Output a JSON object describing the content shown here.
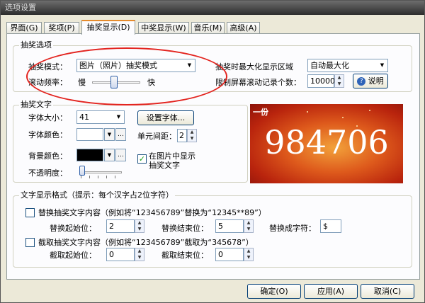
{
  "window": {
    "title": "选项设置"
  },
  "tabs": [
    {
      "label": "界面(G)"
    },
    {
      "label": "奖项(P)"
    },
    {
      "label": "抽奖显示(D)"
    },
    {
      "label": "中奖显示(W)"
    },
    {
      "label": "音乐(M)"
    },
    {
      "label": "高级(A)"
    }
  ],
  "lottery_options": {
    "title": "抽奖选项",
    "mode_label": "抽奖模式：",
    "mode_value": "图片（照片）抽奖模式",
    "speed_label": "滚动频率：",
    "speed_slow": "慢",
    "speed_fast": "快",
    "speed_level": 0.45,
    "maximize_label": "抽奖时最大化显示区域",
    "maximize_value": "自动最大化",
    "limit_label": "限制屏幕滚动记录个数：",
    "limit_value": "10000",
    "help_button": "说明"
  },
  "lottery_text": {
    "title": "抽奖文字",
    "font_size_label": "字体大小：",
    "font_size_value": "41",
    "font_color_label": "字体颜色：",
    "font_color": "#ffffff",
    "set_font_button": "设置字体...",
    "cell_spacing_label": "单元间距：",
    "cell_spacing_value": "2",
    "bg_color_label": "背景颜色：",
    "bg_color": "#000000",
    "opacity_label": "不透明度：",
    "opacity_level": 0.0,
    "show_on_image_label": "在图片中显示\n抽奖文字",
    "show_on_image_checked": true
  },
  "preview": {
    "number": "984706",
    "tag": "一份"
  },
  "text_format": {
    "title": "文字显示格式（提示：每个汉字占2位字符）",
    "replace_label": "替换抽奖文字内容（例如将“123456789”替换为“12345**89”）",
    "replace_checked": false,
    "replace_start_label": "替换起始位：",
    "replace_start_value": "2",
    "replace_end_label": "替换结束位：",
    "replace_end_value": "5",
    "replace_char_label": "替换成字符：",
    "replace_char_value": "$",
    "cut_label": "截取抽奖文字内容（例如将“123456789”截取为“345678”）",
    "cut_checked": false,
    "cut_start_label": "截取起始位：",
    "cut_start_value": "0",
    "cut_end_label": "截取结束位：",
    "cut_end_value": "0"
  },
  "footer": {
    "ok_button": "确定(O)",
    "apply_button": "应用(A)",
    "cancel_button": "取消(C)"
  }
}
